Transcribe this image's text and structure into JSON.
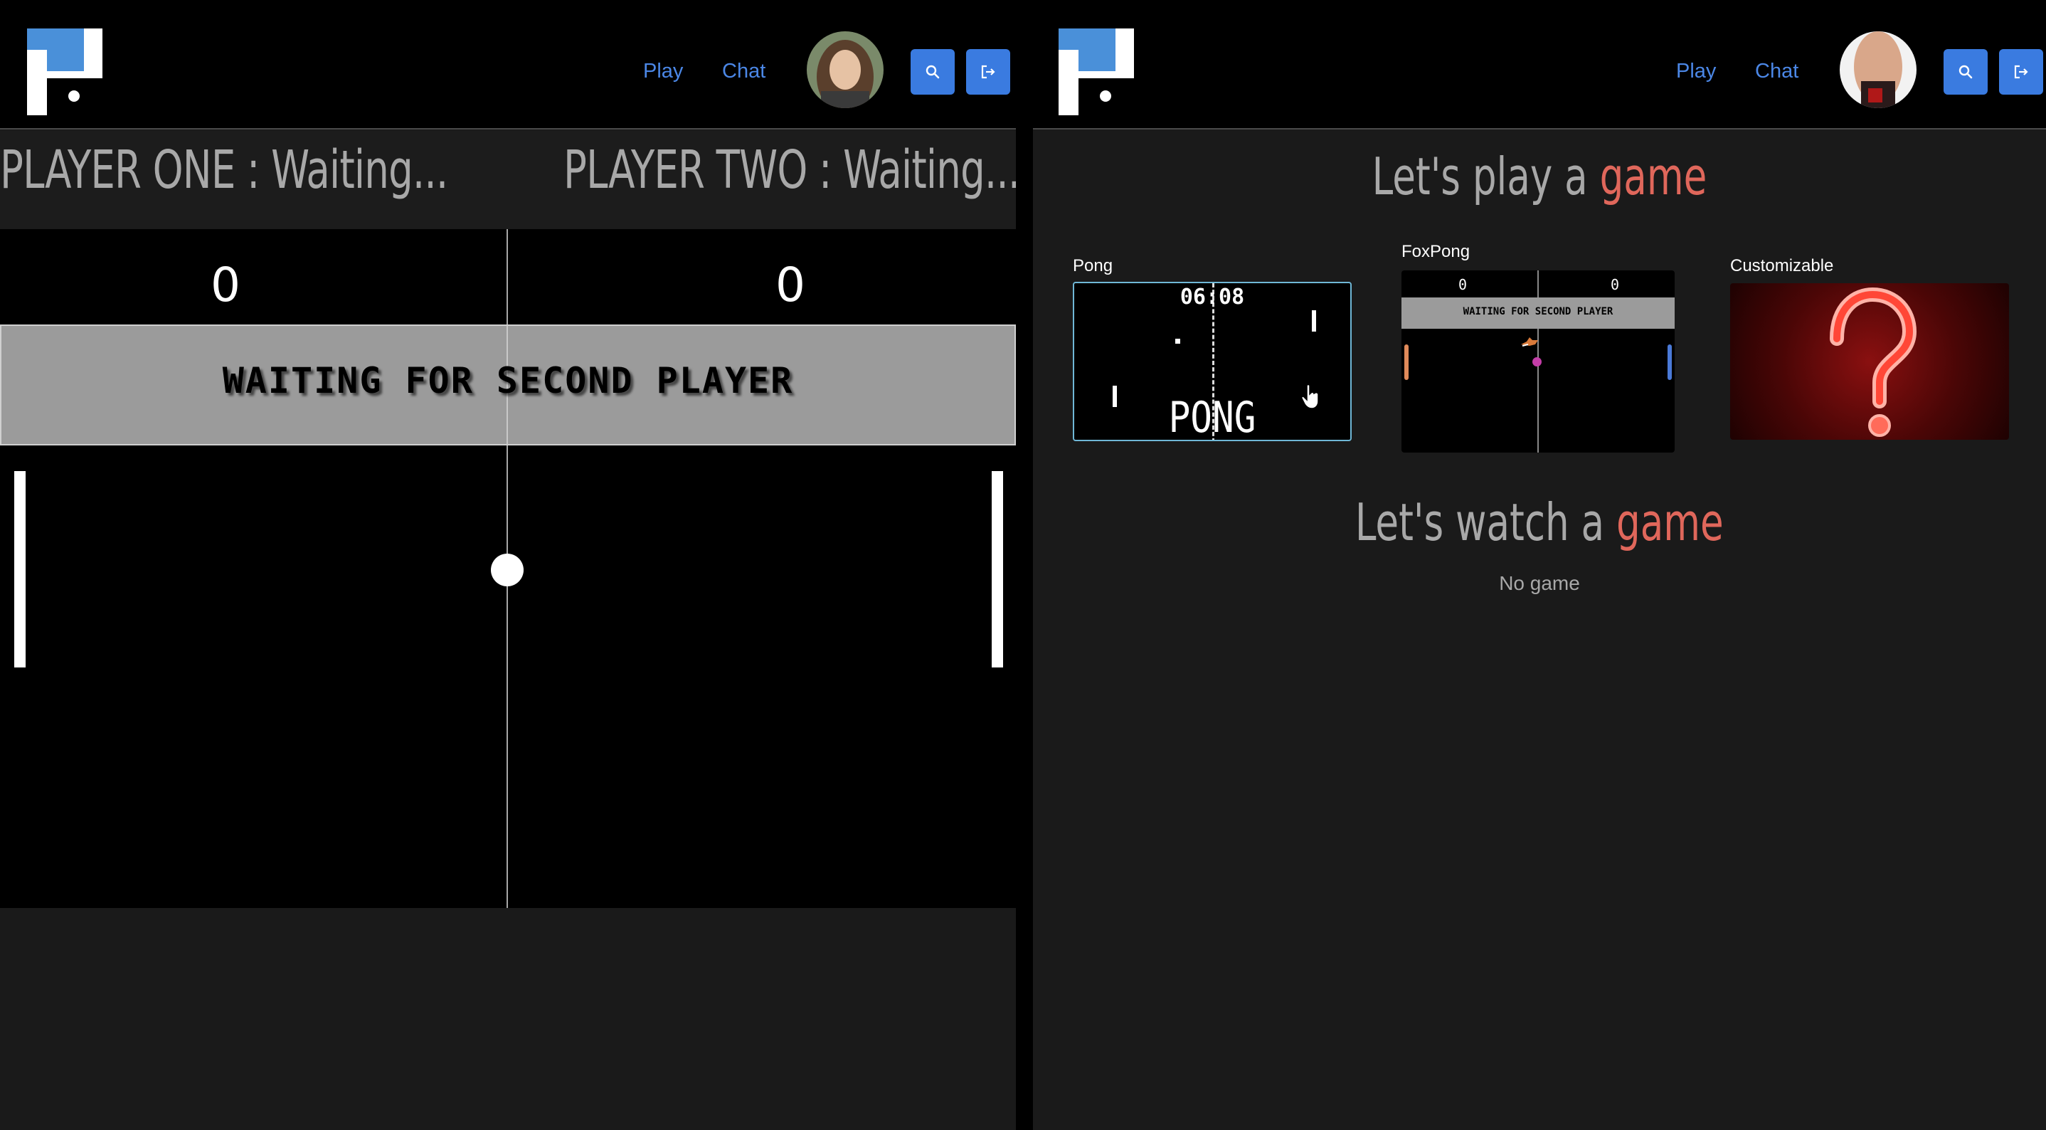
{
  "left_window": {
    "nav": {
      "play": "Play",
      "chat": "Chat"
    },
    "player_one": "PLAYER ONE : Waiting...",
    "player_two": "PLAYER TWO : Waiting...",
    "score_left": "0",
    "score_right": "0",
    "banner": "WAITING FOR SECOND PLAYER"
  },
  "right_window": {
    "nav": {
      "play": "Play",
      "chat": "Chat"
    },
    "play_heading": {
      "prefix": "Let's play a ",
      "accent": "game"
    },
    "games": [
      {
        "label": "Pong",
        "preview_timer": "06:08",
        "preview_title": "PONG"
      },
      {
        "label": "FoxPong",
        "preview_score_left": "0",
        "preview_score_right": "0",
        "preview_banner": "WAITING FOR SECOND PLAYER"
      },
      {
        "label": "Customizable"
      }
    ],
    "watch_heading": {
      "prefix": "Let's watch a ",
      "accent": "game"
    },
    "no_game": "No game"
  },
  "icons": [
    "logo",
    "search-icon",
    "logout-icon",
    "avatar",
    "question-mark-icon",
    "hand-cursor-icon"
  ],
  "colors": {
    "accent_blue": "#3a7be0",
    "link_blue": "#4b87e6",
    "accent_red": "#e0675b",
    "text_gray": "#a8a8a8"
  }
}
